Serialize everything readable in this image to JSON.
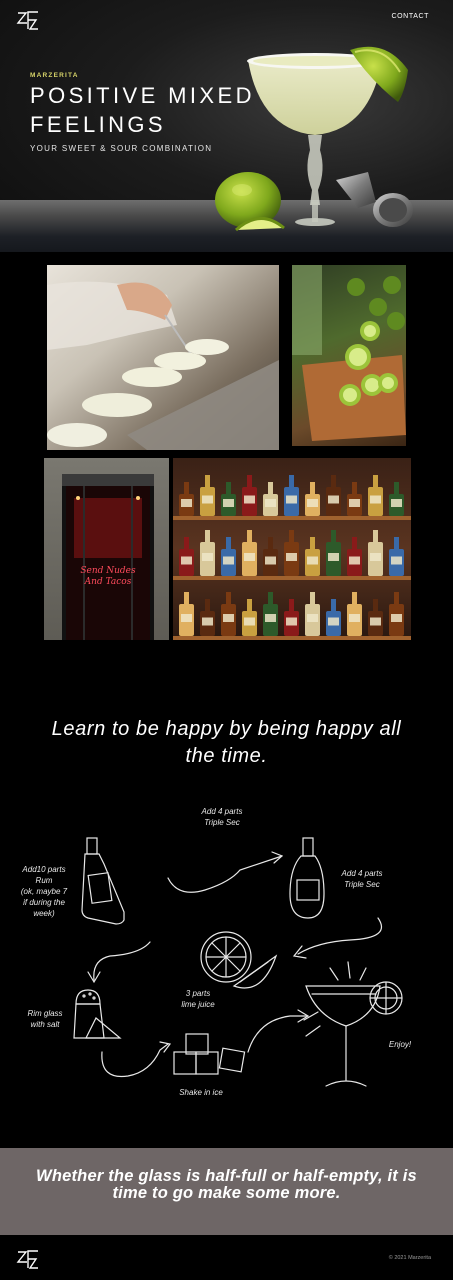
{
  "nav": {
    "contact": "CONTACT"
  },
  "hero": {
    "eyebrow": "MARZERITA",
    "title_line1": "POSITIVE MIXED",
    "title_line2": "FEELINGS",
    "subtitle": "YOUR SWEET & SOUR COMBINATION"
  },
  "gallery": {
    "neon_line1": "Send Nudes",
    "neon_line2": "And Tacos"
  },
  "quote1": {
    "line1": "Learn to be happy by being happy all",
    "line2": "the time."
  },
  "recipe": {
    "step_triple_top": [
      "Add 4 parts",
      "Triple Sec"
    ],
    "step_rum": [
      "Add10 parts",
      "Rum",
      "(ok, maybe 7",
      "if during the",
      "week)"
    ],
    "step_triple_right": [
      "Add 4 parts",
      "Triple Sec"
    ],
    "step_lime": [
      "3 parts",
      "lime juice"
    ],
    "step_salt": [
      "Rim glass",
      "with salt"
    ],
    "step_enjoy": [
      "Enjoy!"
    ],
    "step_ice": [
      "Shake in ice"
    ]
  },
  "quote2": {
    "line1": "Whether the glass is half-full or half-empty, it is",
    "line2": "time to go make some more."
  },
  "footer": {
    "copyright": "© 2021 Marzerita"
  },
  "colors": {
    "accent": "#d8d56a",
    "band": "#6e6666",
    "background": "#000000"
  }
}
